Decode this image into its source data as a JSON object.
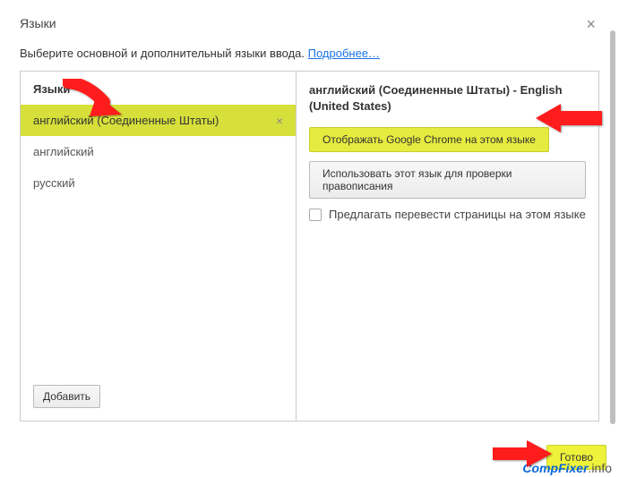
{
  "dialog": {
    "title": "Языки",
    "subtitle_prefix": "Выберите основной и дополнительный языки ввода. ",
    "learn_more": "Подробнее…"
  },
  "left": {
    "header": "Языки",
    "items": [
      {
        "label": "английский (Соединенные Штаты)",
        "selected": true
      },
      {
        "label": "английский",
        "selected": false
      },
      {
        "label": "русский",
        "selected": false
      }
    ],
    "add_button": "Добавить"
  },
  "right": {
    "title": "английский (Соединенные Штаты) - English (United States)",
    "display_button": "Отображать Google Chrome на этом языке",
    "spellcheck_button": "Использовать этот язык для проверки правописания",
    "offer_translate": "Предлагать перевести страницы на этом языке"
  },
  "footer": {
    "done": "Готово"
  },
  "watermark": {
    "brand": "CompFixer",
    "suffix": ".info"
  },
  "colors": {
    "highlight": "#d7e03a",
    "arrow": "#ff1a1a",
    "link": "#1a73e8"
  }
}
